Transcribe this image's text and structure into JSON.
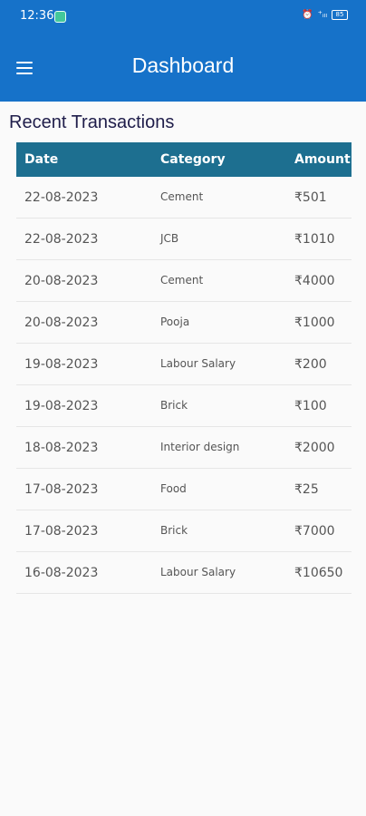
{
  "status_bar": {
    "time": "12:36",
    "signal_text": "⁺ᵢₗₗ",
    "battery": "85"
  },
  "app_bar": {
    "title": "Dashboard",
    "background_color": "#1672c9"
  },
  "section": {
    "title": "Recent Transactions"
  },
  "table": {
    "header_color": "#1d6f90",
    "columns": [
      "Date",
      "Category",
      "Amount"
    ],
    "rows": [
      {
        "date": "22-08-2023",
        "category": "Cement",
        "amount": "₹501"
      },
      {
        "date": "22-08-2023",
        "category": "JCB",
        "amount": "₹1010"
      },
      {
        "date": "20-08-2023",
        "category": "Cement",
        "amount": "₹4000"
      },
      {
        "date": "20-08-2023",
        "category": "Pooja",
        "amount": "₹1000"
      },
      {
        "date": "19-08-2023",
        "category": "Labour Salary",
        "amount": "₹200"
      },
      {
        "date": "19-08-2023",
        "category": "Brick",
        "amount": "₹100"
      },
      {
        "date": "18-08-2023",
        "category": "Interior design",
        "amount": "₹2000"
      },
      {
        "date": "17-08-2023",
        "category": "Food",
        "amount": "₹25"
      },
      {
        "date": "17-08-2023",
        "category": "Brick",
        "amount": "₹7000"
      },
      {
        "date": "16-08-2023",
        "category": "Labour Salary",
        "amount": "₹10650"
      }
    ]
  }
}
